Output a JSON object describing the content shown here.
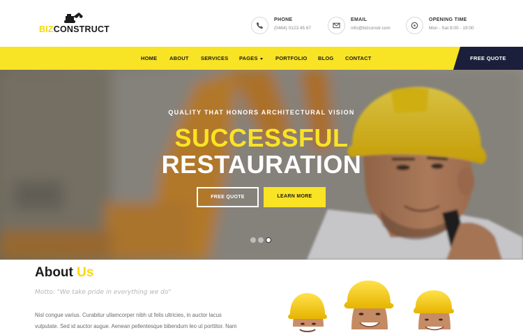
{
  "brand": {
    "prefix": "BIZ",
    "name": "CONSTRUCT"
  },
  "contacts": [
    {
      "icon": "phone-icon",
      "title": "PHONE",
      "value": "(0464) 0123 45 67"
    },
    {
      "icon": "mail-icon",
      "title": "EMAIL",
      "value": "info@bizconstr.com"
    },
    {
      "icon": "clock-icon",
      "title": "OPENING TIME",
      "value": "Mon - Sat 8:00 - 19:00"
    }
  ],
  "nav": {
    "items": [
      {
        "label": "HOME"
      },
      {
        "label": "ABOUT"
      },
      {
        "label": "SERVICES"
      },
      {
        "label": "PAGES"
      },
      {
        "label": "PORTFOLIO"
      },
      {
        "label": "BLOG"
      },
      {
        "label": "CONTACT"
      }
    ],
    "quote_label": "FREE QUOTE"
  },
  "hero": {
    "subtitle": "QUALITY THAT HONORS ARCHITECTURAL VISION",
    "title_line1": "SUCCESSFUL",
    "title_line2": "RESTAURATION",
    "btn_quote": "FREE QUOTE",
    "btn_learn": "LEARN MORE",
    "slides_total": 3,
    "active_slide": 3
  },
  "about": {
    "title_main": "About",
    "title_accent": "Us",
    "motto": "Motto: \"We take pride in everything we do\"",
    "body": "Nisl congue varius. Curabitur ullamcorper nibh ut felis ultricies, in auctor lacus vulputate. Sed id auctor augue. Aenean pellentesque bibendum leo ut porttitor. Nam non odio purus. Vivamus cursus sodales. Nisl congue varius. Curabitur"
  },
  "colors": {
    "accent_yellow": "#f9e325",
    "navy": "#1c1f3b",
    "text_dark": "#1b1b1b"
  }
}
